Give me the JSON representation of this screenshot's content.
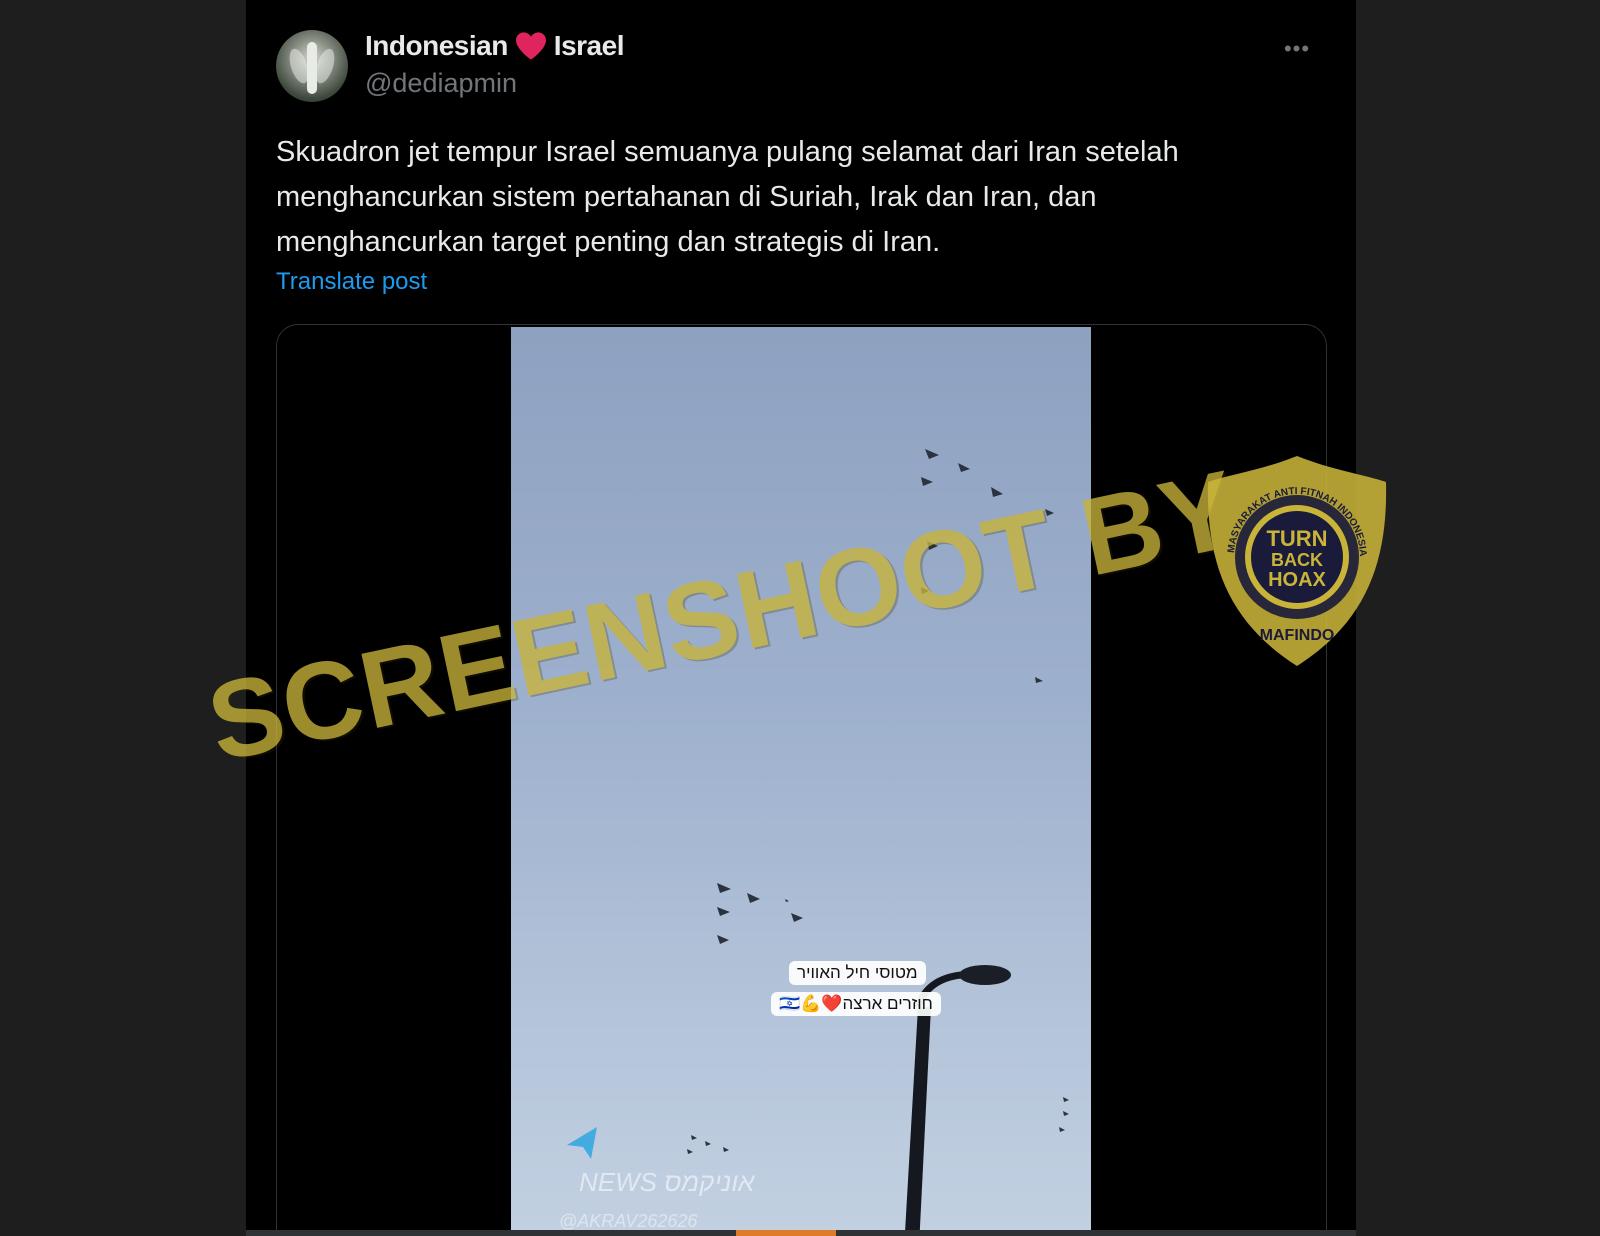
{
  "tweet": {
    "author_name_part1": "Indonesian",
    "author_name_part2": "Israel",
    "handle": "@dediapmin",
    "text": "Skuadron jet tempur Israel semuanya pulang selamat dari Iran setelah menghancurkan sistem pertahanan di Suriah, Irak dan Iran, dan menghancurkan target penting dan strategis di Iran.",
    "translate_label": "Translate post",
    "more_label": "•••"
  },
  "video": {
    "caption_line1": "מטוסי חיל האוויר",
    "caption_line2": "חוזרים ארצה❤️💪🇮🇱",
    "watermark_news": "NEWS אוניקמס",
    "watermark_handle": "@AKRAV262626",
    "progress": 0.48
  },
  "overlay": {
    "stamp_text": "SCREENSHOOT BY",
    "badge_text": "MASYARAKAT ANTI FITNAH INDONESIA",
    "badge_center": "TURN BACK HOAX",
    "badge_bottom": "MAFINDO"
  },
  "colors": {
    "background": "#000000",
    "text": "#e7e9ea",
    "muted": "#71767b",
    "link": "#1d9bf0",
    "heart": "#f91880",
    "stamp": "#c9b43a"
  }
}
